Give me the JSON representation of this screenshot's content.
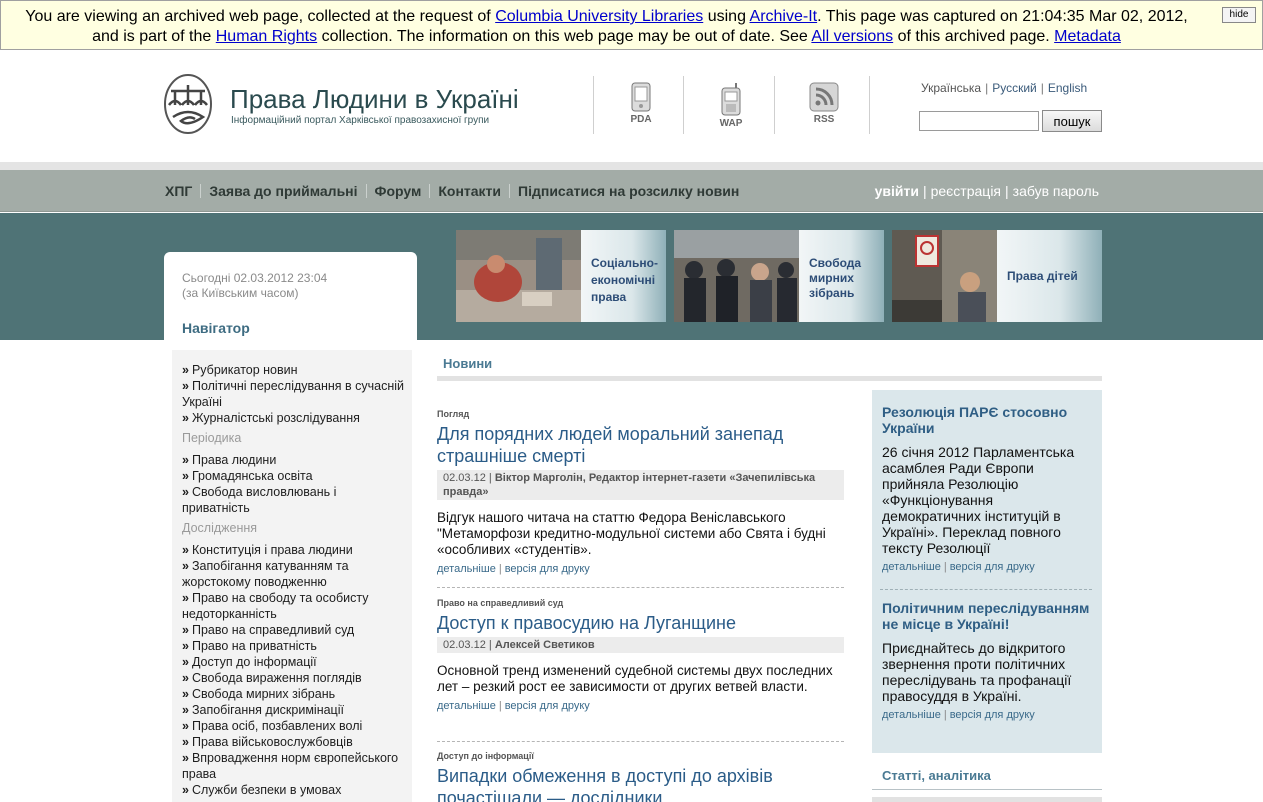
{
  "archive_banner": {
    "t1": "You are viewing an archived web page, collected at the request of ",
    "l1": "Columbia University Libraries",
    "t2": " using ",
    "l2": "Archive-It",
    "t3": ". This page was captured on 21:04:35 Mar 02, 2012, and is part of the ",
    "l3": "Human Rights",
    "t4": " collection. The information on this web page may be out of date. See ",
    "l4": "All versions",
    "t5": " of this archived page. ",
    "l5": "Metadata",
    "hide": "hide"
  },
  "header": {
    "title": "Права Людини в Україні",
    "subtitle": "Інформаційний портал Харківської правозахисної групи",
    "devices": [
      {
        "label": "PDA",
        "icon": "pda-phone-icon"
      },
      {
        "label": "WAP",
        "icon": "wap-phone-icon"
      },
      {
        "label": "RSS",
        "icon": "rss-feed-icon"
      }
    ],
    "languages": {
      "current": "Українська",
      "ru": "Русский",
      "en": "English",
      "sep": "|"
    },
    "search_button": "пошук"
  },
  "nav": {
    "items": [
      "ХПГ",
      "Заява до приймальні",
      "Форум",
      "Контакти",
      "Підписатися на розсилку новин"
    ],
    "login": "увійти",
    "register": "реєстрація",
    "forgot": "забув пароль",
    "sep": "|"
  },
  "date_box": {
    "line1": "Сьогодні 02.03.2012 23:04",
    "line2": "(за Київським часом)",
    "navigator": "Навігатор"
  },
  "banners": [
    {
      "label_lines": [
        "Соціально-",
        "економічні",
        "права"
      ]
    },
    {
      "label_lines": [
        "Свобода",
        "мирних",
        "зібрань"
      ]
    },
    {
      "label_lines": [
        "Права дітей"
      ]
    }
  ],
  "sidebar": {
    "bullet": "»",
    "group1": [
      "Рубрикатор новин",
      "Політичні переслідування в сучасній Україні",
      "Журналістські розслідування"
    ],
    "sec_periodika": "Періодика",
    "group2": [
      "Права людини",
      "Громадянська освіта",
      "Свобода висловлювань і приватність"
    ],
    "sec_research": "Дослідження",
    "group3": [
      "Конституція і права людини",
      "Запобігання катуванням та жорстокому поводженню",
      "Право на свободу та особисту недоторканність",
      "Право на справедливий суд",
      "Право на приватність",
      "Доступ до інформації",
      "Свобода вираження поглядів",
      "Свобода мирних зібрань",
      "Запобігання дискримінації",
      "Права осіб, позбавлених волі",
      "Права військовослужбовців",
      "Впровадження норм європейського права",
      "Служби безпеки в умовах"
    ]
  },
  "news": {
    "heading": "Новини",
    "articles": [
      {
        "category": "Погляд",
        "title": "Для порядних людей моральний занепад страшніше смерті",
        "date": "02.03.12",
        "author": "Віктор Марголін, Редактор інтернет-газети «Зачепилівська правда»",
        "body": "Відгук нашого читача на статтю Федора Веніславського \"Метаморфози кредитно-модульної системи або Свята і будні «особливих «студентів».",
        "more": "детальніше",
        "print": "версія для друку"
      },
      {
        "category": "Право на справедливий суд",
        "title": "Доступ к правосудию на Луганщине",
        "date": "02.03.12",
        "author": "Алексей Светиков",
        "body": "Основной тренд изменений судебной системы двух последних лет – резкий рост ее зависимости от других ветвей власти.",
        "more": "детальніше",
        "print": "версія для друку"
      },
      {
        "category": "Доступ до інформації",
        "title": "Випадки обмеження в доступі до архівів почастішали — дослідники",
        "date": "",
        "author": "",
        "body": "",
        "more": "",
        "print": ""
      }
    ]
  },
  "right": {
    "blocks": [
      {
        "title": "Резолюція ПАРЄ стосовно України",
        "text": "26 січня 2012 Парламентська асамблея Ради Європи прийняла Резолюцію «Функціонування демократичних інституцій в Україні». Переклад повного тексту Резолюції",
        "more": "детальніше",
        "print": "версія для друку"
      },
      {
        "title": "Політичним переслідуванням не місце в Україні!",
        "text": "Приєднайтесь до відкритого звернення проти політичних переслідувань та профанації правосуддя в Україні.",
        "more": "детальніше",
        "print": "версія для друку"
      }
    ],
    "articles_heading": "Статті, аналітика"
  },
  "colors": {
    "teal_band": "#4f7376",
    "nav_bar": "#a3aca7",
    "link_blue": "#2b5c88",
    "right_box": "#dbe7eb",
    "archive_bg": "#ffffe1"
  }
}
